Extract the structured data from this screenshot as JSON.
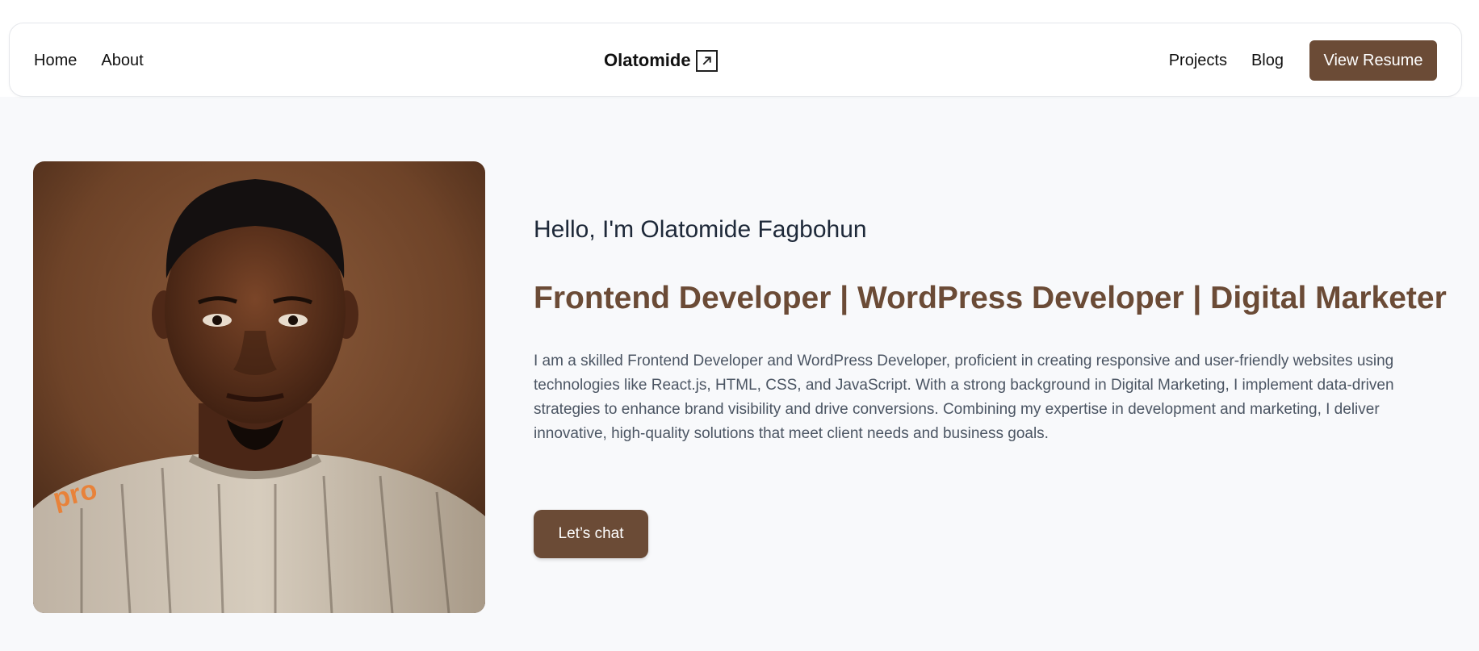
{
  "nav": {
    "left": [
      "Home",
      "About"
    ],
    "brand": "Olatomide",
    "brand_icon": "arrow-up-right-icon",
    "right": [
      "Projects",
      "Blog"
    ],
    "resume_label": "View Resume"
  },
  "hero": {
    "greeting": "Hello, I'm Olatomide Fagbohun",
    "headline": "Frontend Developer | WordPress Developer | Digital Marketer",
    "bio": "I am a skilled Frontend Developer and WordPress Developer, proficient in creating responsive and user-friendly websites using technologies like React.js, HTML, CSS, and JavaScript. With a strong background in Digital Marketing, I implement data-driven strategies to enhance brand visibility and drive conversions. Combining my expertise in development and marketing, I deliver innovative, high-quality solutions that meet client needs and business goals.",
    "cta_label": "Let’s chat",
    "photo_logo_text": "pro"
  },
  "colors": {
    "accent": "#6b4b36",
    "page_bg": "#f8f9fb",
    "heading_dark": "#1e2939",
    "body_text": "#4b5563"
  }
}
